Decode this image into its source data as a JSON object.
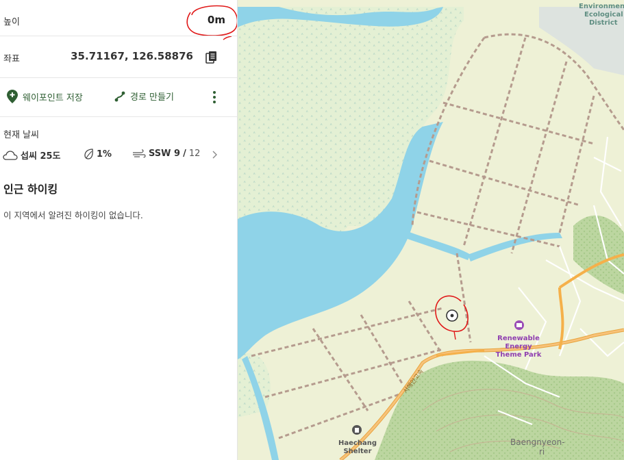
{
  "panel": {
    "elevation": {
      "label": "높이",
      "value": "0m"
    },
    "coordinates": {
      "label": "좌표",
      "value": "35.71167, 126.58876"
    },
    "actions": {
      "save_waypoint": "웨이포인트 저장",
      "make_route": "경로 만들기"
    },
    "weather": {
      "title": "현재 날씨",
      "temperature": "섭씨 25도",
      "precipitation": "1%",
      "wind_dir_speed": "SSW 9",
      "wind_sep": "/",
      "wind_gust": "12"
    },
    "nearby_hikes": {
      "title": "인근 하이킹",
      "empty_text": "이 지역에서 알려진 하이킹이 없습니다."
    }
  },
  "map": {
    "labels": {
      "district_1": "Environment",
      "district_2": "Ecological",
      "district_3": "District",
      "park_1": "Renewable",
      "park_2": "Energy",
      "park_3": "Theme Park",
      "shelter_1": "Haechang",
      "shelter_2": "Shelter",
      "village_1": "Baengnyeon-",
      "village_2": "ri",
      "road": "서해안고속"
    }
  },
  "colors": {
    "accent_green": "#2f5f33",
    "water": "#8fd3e8",
    "road": "#f5b04a",
    "annotation_red": "#e01818"
  },
  "icons": {
    "copy": "copy-icon",
    "waypoint": "waypoint-pin-icon",
    "route": "route-icon",
    "more": "more-vertical-icon",
    "weather": "cloud-icon",
    "rain": "leaf-drop-icon",
    "wind": "wind-icon",
    "chevron": "chevron-right-icon"
  }
}
